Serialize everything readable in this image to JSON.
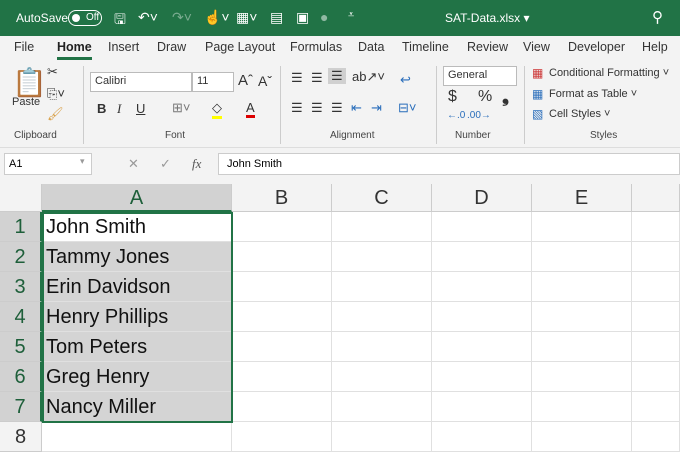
{
  "titlebar": {
    "autosave": "AutoSave",
    "toggle": "Off",
    "filename": "SAT-Data.xlsx ▾"
  },
  "tabs": [
    "File",
    "Home",
    "Insert",
    "Draw",
    "Page Layout",
    "Formulas",
    "Data",
    "Timeline",
    "Review",
    "View",
    "Developer",
    "Help"
  ],
  "ribbon": {
    "clipboard": {
      "paste": "Paste",
      "label": "Clipboard"
    },
    "font": {
      "name": "Calibri",
      "size": "11",
      "bold": "B",
      "italic": "I",
      "underline": "U",
      "label": "Font"
    },
    "alignment": {
      "label": "Alignment"
    },
    "number": {
      "format": "General",
      "currency": "$",
      "percent": "%",
      "comma": "❟",
      "label": "Number"
    },
    "styles": {
      "conditional": "Conditional Formatting ˅",
      "table": "Format as Table ˅",
      "cell": "Cell Styles ˅",
      "label": "Styles"
    }
  },
  "formula_bar": {
    "name_box": "A1",
    "fx": "fx",
    "value": "John Smith"
  },
  "columns": [
    "A",
    "B",
    "C",
    "D",
    "E"
  ],
  "rows": [
    "1",
    "2",
    "3",
    "4",
    "5",
    "6",
    "7",
    "8"
  ],
  "cells": [
    "John Smith",
    "Tammy Jones",
    "Erin Davidson",
    "Henry Phillips",
    "Tom Peters",
    "Greg Henry",
    "Nancy Miller"
  ]
}
